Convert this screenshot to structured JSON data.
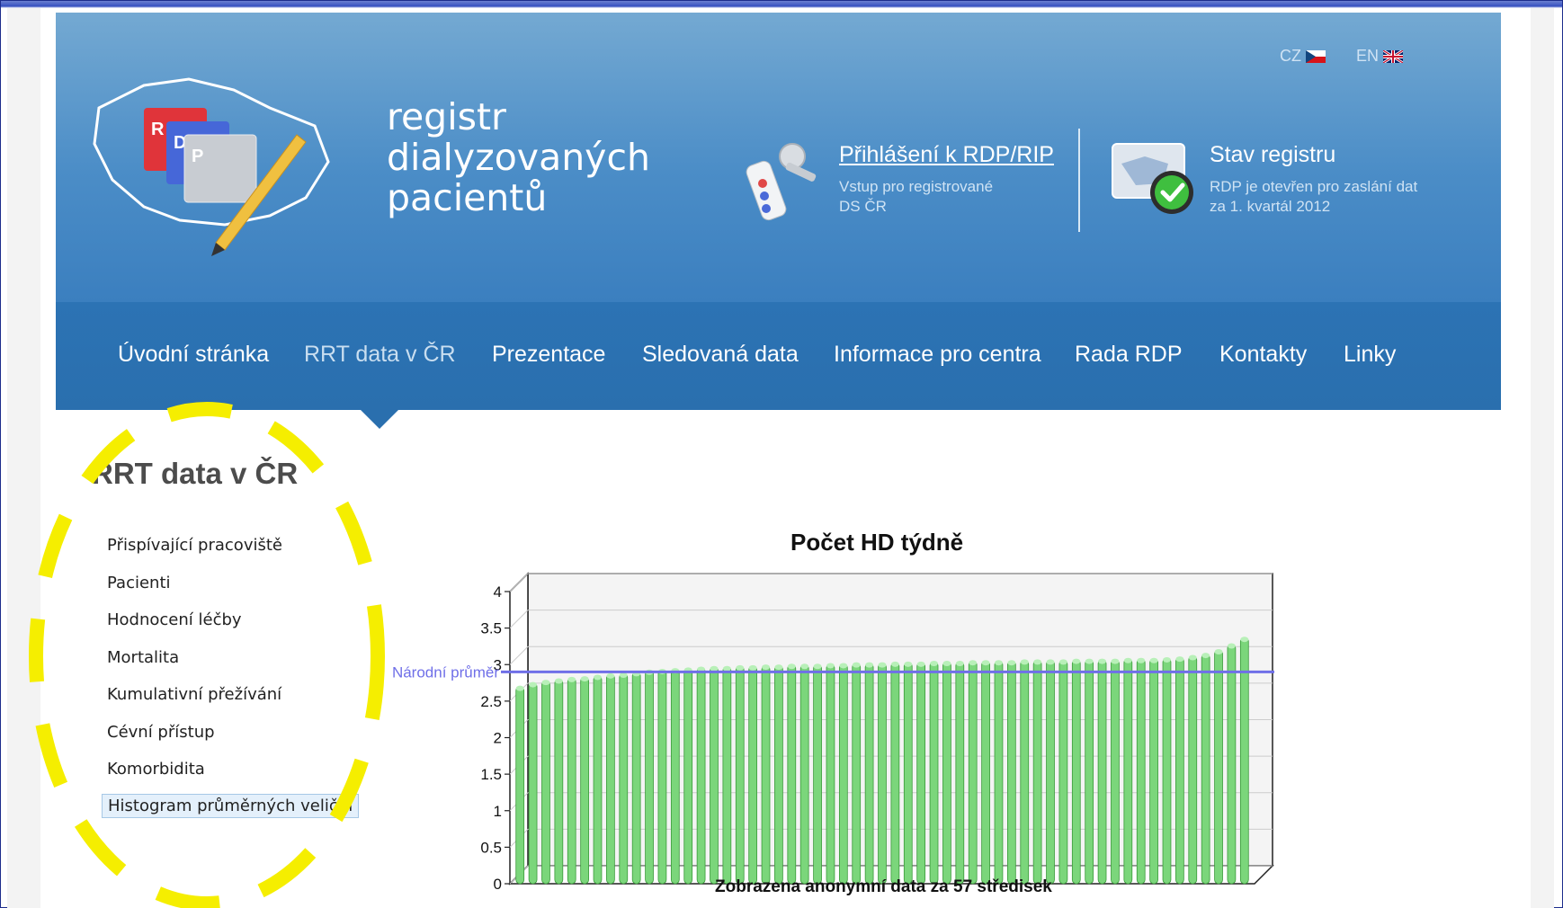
{
  "logo": {
    "line1": "registr",
    "line2": "dialyzovaných",
    "line3": "pacientů",
    "folder_letters": [
      "R",
      "D",
      "P"
    ]
  },
  "languages": [
    {
      "code": "CZ"
    },
    {
      "code": "EN"
    }
  ],
  "login": {
    "title": "Přihlášení k RDP/RIP",
    "subtitle_line1": "Vstup pro registrované",
    "subtitle_line2": "DS ČR"
  },
  "status": {
    "title": "Stav registru",
    "subtitle_line1": "RDP je otevřen pro zaslání dat",
    "subtitle_line2": "za 1. kvartál 2012"
  },
  "nav": {
    "items": [
      {
        "label": "Úvodní stránka",
        "active": false
      },
      {
        "label": "RRT data v ČR",
        "active": true
      },
      {
        "label": "Prezentace",
        "active": false
      },
      {
        "label": "Sledovaná data",
        "active": false
      },
      {
        "label": "Informace pro centra",
        "active": false
      },
      {
        "label": "Rada RDP",
        "active": false
      },
      {
        "label": "Kontakty",
        "active": false
      },
      {
        "label": "Linky",
        "active": false
      }
    ]
  },
  "sidebar": {
    "title": "RRT data v ČR",
    "items": [
      {
        "label": "Přispívající pracoviště",
        "selected": false
      },
      {
        "label": "Pacienti",
        "selected": false
      },
      {
        "label": "Hodnocení léčby",
        "selected": false
      },
      {
        "label": "Mortalita",
        "selected": false
      },
      {
        "label": "Kumulativní přežívání",
        "selected": false
      },
      {
        "label": "Cévní přístup",
        "selected": false
      },
      {
        "label": "Komorbidita",
        "selected": false
      },
      {
        "label": "Histogram průměrných veličin",
        "selected": true
      }
    ]
  },
  "chart_data": {
    "type": "bar",
    "title": "Počet HD týdně",
    "footer": "Zobrazena anonymní data za 57 středisek",
    "ylim": [
      0,
      4
    ],
    "yticks": [
      "0",
      "0.5",
      "1",
      "1.5",
      "2",
      "2.5",
      "3",
      "3.5",
      "4"
    ],
    "grid": true,
    "reference_line": {
      "label": "Národní průměr",
      "value": 2.9
    },
    "values": [
      2.7,
      2.75,
      2.78,
      2.8,
      2.82,
      2.83,
      2.85,
      2.87,
      2.88,
      2.9,
      2.92,
      2.93,
      2.94,
      2.95,
      2.96,
      2.97,
      2.97,
      2.98,
      2.98,
      2.99,
      2.99,
      3.0,
      3.0,
      3.0,
      3.01,
      3.01,
      3.02,
      3.02,
      3.02,
      3.03,
      3.03,
      3.03,
      3.04,
      3.04,
      3.04,
      3.05,
      3.05,
      3.05,
      3.05,
      3.06,
      3.06,
      3.06,
      3.06,
      3.07,
      3.07,
      3.07,
      3.07,
      3.08,
      3.08,
      3.08,
      3.09,
      3.1,
      3.12,
      3.15,
      3.2,
      3.28,
      3.37
    ],
    "bar_color": "#7bd67b",
    "reference_color": "#6f6fe8"
  },
  "colors": {
    "header_blue": "#4b8dc7",
    "nav_blue": "#2a6fae",
    "highlight_yellow": "#f5ee00"
  }
}
